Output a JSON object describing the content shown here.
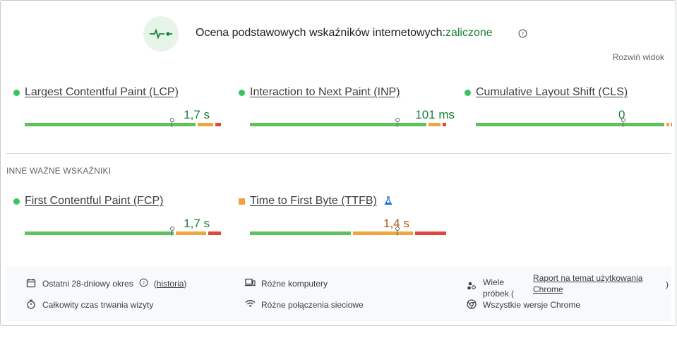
{
  "header": {
    "title": "Ocena podstawowych wskaźników internetowych:",
    "status": "zaliczone",
    "expand_label": "Rozwiń widok",
    "status_color": "#188038"
  },
  "metrics": [
    {
      "name": "Largest Contentful Paint (LCP)",
      "value": "1,7 s",
      "rating": "good",
      "marker_position": 0.75,
      "distribution": [
        0.875,
        0.09,
        0.035
      ]
    },
    {
      "name": "Interaction to Next Paint (INP)",
      "value": "101 ms",
      "rating": "good",
      "marker_position": 0.75,
      "distribution": [
        0.905,
        0.07,
        0.025
      ]
    },
    {
      "name": "Cumulative Layout Shift (CLS)",
      "value": "0",
      "rating": "good",
      "marker_position": 0.75,
      "distribution": [
        0.965,
        0.025,
        0.01
      ]
    }
  ],
  "other_section_label": "INNE WAŻNE WSKAŹNIKI",
  "other_metrics": [
    {
      "name": "First Contentful Paint (FCP)",
      "value": "1,7 s",
      "rating": "good",
      "marker_position": 0.75,
      "distribution": [
        0.765,
        0.165,
        0.07
      ]
    },
    {
      "name": "Time to First Byte (TTFB)",
      "value": "1,4 s",
      "rating": "needs-improvement",
      "marker_position": 0.75,
      "distribution": [
        0.52,
        0.315,
        0.165
      ],
      "experimental": true
    }
  ],
  "footer": {
    "period": "Ostatni 28-dniowy okres",
    "history_link": "historia",
    "devices": "Różne komputery",
    "samples_line1": "Wiele",
    "samples_line2": "próbek (",
    "report_link_line1": "Raport na temat użytkowania",
    "report_link_line2": "Chrome",
    "samples_close": ")",
    "visit_duration": "Całkowity czas trwania wizyty",
    "connections": "Różne połączenia sieciowe",
    "chrome_versions": "Wszystkie wersje Chrome"
  }
}
